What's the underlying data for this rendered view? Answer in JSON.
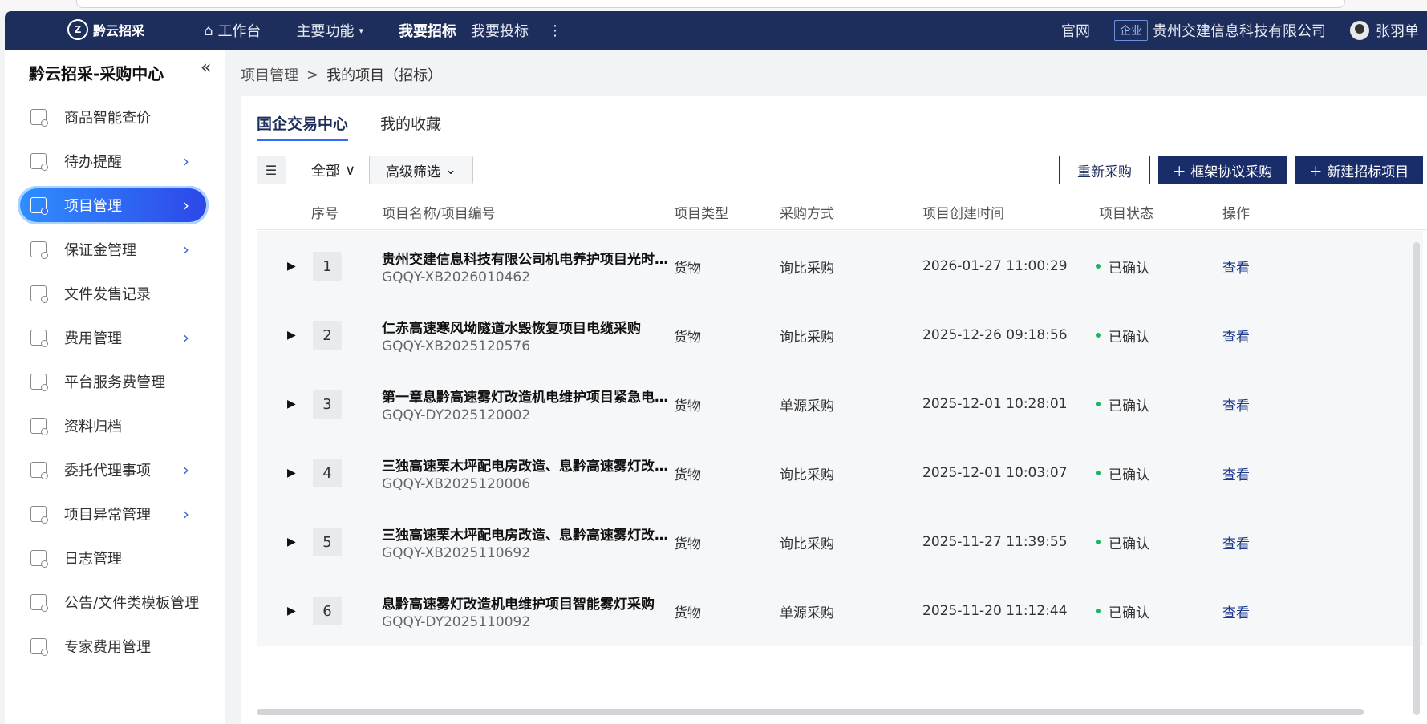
{
  "topbar": {
    "logo": "黔云招采",
    "nav": [
      {
        "label": "工作台",
        "icon": "home-icon"
      },
      {
        "label": "主要功能",
        "caret": "▾"
      },
      {
        "label": "我要招标",
        "active": true
      },
      {
        "label": "我要投标"
      }
    ],
    "more": "⋮",
    "official": "官网",
    "tag": "企业",
    "company": "贵州交建信息科技有限公司",
    "user": "张羽单"
  },
  "sidebar": {
    "title": "黔云招采-采购中心",
    "collapse": "«",
    "items": [
      {
        "label": "商品智能查价",
        "chevron": false
      },
      {
        "label": "待办提醒",
        "chevron": true
      },
      {
        "label": "项目管理",
        "chevron": true,
        "active": true
      },
      {
        "label": "保证金管理",
        "chevron": true
      },
      {
        "label": "文件发售记录",
        "chevron": false
      },
      {
        "label": "费用管理",
        "chevron": true
      },
      {
        "label": "平台服务费管理",
        "chevron": false
      },
      {
        "label": "资料归档",
        "chevron": false
      },
      {
        "label": "委托代理事项",
        "chevron": true
      },
      {
        "label": "项目异常管理",
        "chevron": true
      },
      {
        "label": "日志管理",
        "chevron": false
      },
      {
        "label": "公告/文件类模板管理",
        "chevron": false
      },
      {
        "label": "专家费用管理",
        "chevron": false
      }
    ]
  },
  "breadcrumb": {
    "root": "项目管理",
    "sep": ">",
    "current": "我的项目（招标）"
  },
  "tabs": [
    "国企交易中心",
    "我的收藏"
  ],
  "toolbar": {
    "list_icon": "☰",
    "all": "全部",
    "advanced": "高级筛选",
    "repurchase": "重新采购",
    "framework": "＋ 框架协议采购",
    "new_project": "＋ 新建招标项目"
  },
  "table": {
    "headers": [
      "序号",
      "项目名称/项目编号",
      "项目类型",
      "采购方式",
      "项目创建时间",
      "项目状态",
      "操作"
    ],
    "rows": [
      {
        "idx": "1",
        "name": "贵州交建信息科技有限公司机电养护项目光时…",
        "code": "GQQY-XB2026010462",
        "type": "货物",
        "method": "询比采购",
        "created": "2026-01-27 11:00:29",
        "status": "已确认",
        "action": "查看"
      },
      {
        "idx": "2",
        "name": "仁赤高速寒风坳隧道水毁恢复项目电缆采购",
        "code": "GQQY-XB2025120576",
        "type": "货物",
        "method": "询比采购",
        "created": "2025-12-26 09:18:56",
        "status": "已确认",
        "action": "查看"
      },
      {
        "idx": "3",
        "name": "第一章息黔高速雾灯改造机电维护项目紧急电…",
        "code": "GQQY-DY2025120002",
        "type": "货物",
        "method": "单源采购",
        "created": "2025-12-01 10:28:01",
        "status": "已确认",
        "action": "查看"
      },
      {
        "idx": "4",
        "name": "三独高速栗木坪配电房改造、息黔高速雾灯改…",
        "code": "GQQY-XB2025120006",
        "type": "货物",
        "method": "询比采购",
        "created": "2025-12-01 10:03:07",
        "status": "已确认",
        "action": "查看"
      },
      {
        "idx": "5",
        "name": "三独高速栗木坪配电房改造、息黔高速雾灯改…",
        "code": "GQQY-XB2025110692",
        "type": "货物",
        "method": "询比采购",
        "created": "2025-11-27 11:39:55",
        "status": "已确认",
        "action": "查看"
      },
      {
        "idx": "6",
        "name": "息黔高速雾灯改造机电维护项目智能雾灯采购",
        "code": "GQQY-DY2025110092",
        "type": "货物",
        "method": "单源采购",
        "created": "2025-11-20 11:12:44",
        "status": "已确认",
        "action": "查看"
      }
    ]
  }
}
